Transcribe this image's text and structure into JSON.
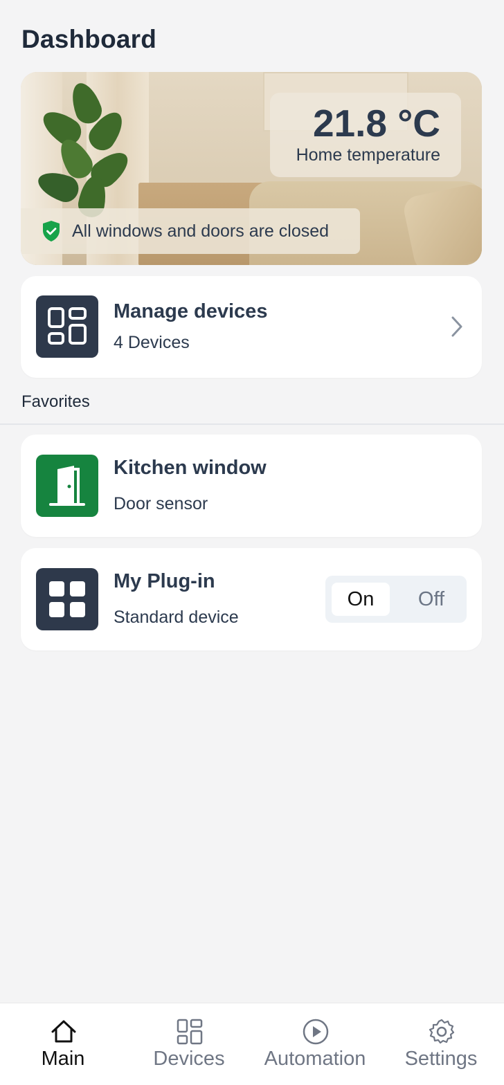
{
  "header": {
    "title": "Dashboard"
  },
  "hero": {
    "temperature": "21.8 °C",
    "temperature_label": "Home temperature",
    "status": "All windows and doors are closed"
  },
  "manage": {
    "title": "Manage devices",
    "subtitle": "4 Devices"
  },
  "favorites": {
    "section_label": "Favorites",
    "items": [
      {
        "title": "Kitchen window",
        "subtitle": "Door sensor",
        "icon": "door-icon",
        "color": "#16843f"
      },
      {
        "title": "My Plug-in",
        "subtitle": "Standard device",
        "icon": "grid-icon",
        "color": "#2e394b",
        "toggle": {
          "on_label": "On",
          "off_label": "Off",
          "selected": "On"
        }
      }
    ]
  },
  "tabbar": {
    "tabs": [
      {
        "label": "Main",
        "icon": "home-icon",
        "active": true
      },
      {
        "label": "Devices",
        "icon": "devices-icon",
        "active": false
      },
      {
        "label": "Automation",
        "icon": "play-icon",
        "active": false
      },
      {
        "label": "Settings",
        "icon": "gear-icon",
        "active": false
      }
    ]
  },
  "colors": {
    "accent_dark": "#2e394b",
    "success": "#16843f",
    "background": "#f4f4f5"
  }
}
